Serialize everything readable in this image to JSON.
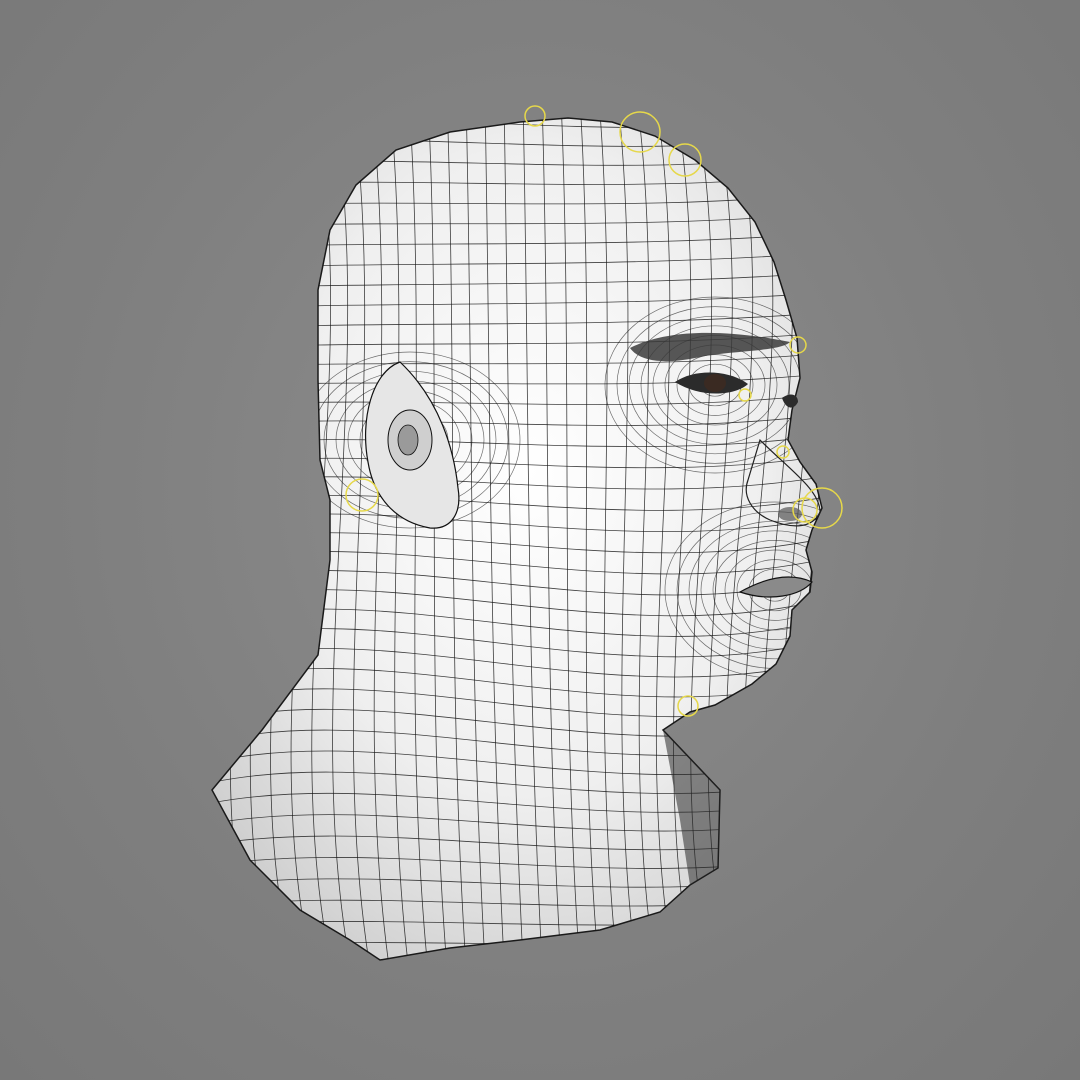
{
  "scene": {
    "background_color": "#808080",
    "model": {
      "subject": "head-and-neck-mesh",
      "shading": "smooth-white-with-black-wireframe",
      "surface_color": "#eeeeee",
      "wire_color": "#111111"
    },
    "rig_controls": {
      "color": "#e6d84a",
      "shape": "circle"
    }
  }
}
